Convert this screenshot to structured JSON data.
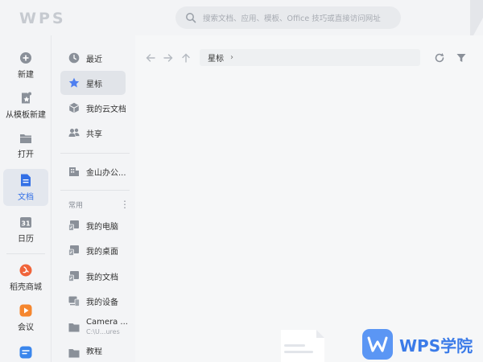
{
  "app": {
    "logo_text": "WPS",
    "search_placeholder": "搜索文档、应用、模板、Office 技巧或直接访问网址"
  },
  "rail": {
    "items": [
      {
        "label": "新建",
        "icon": "plus-circle-icon"
      },
      {
        "label": "从模板新建",
        "icon": "template-icon"
      },
      {
        "label": "打开",
        "icon": "folder-icon"
      },
      {
        "label": "文档",
        "icon": "document-icon",
        "active": true
      },
      {
        "label": "日历",
        "icon": "calendar-icon",
        "day": "31"
      },
      {
        "label": "稻壳商城",
        "icon": "daoke-icon"
      },
      {
        "label": "会议",
        "icon": "meeting-icon"
      }
    ]
  },
  "nav": {
    "items": [
      {
        "label": "最近",
        "icon": "clock-icon"
      },
      {
        "label": "星标",
        "icon": "star-icon",
        "active": true
      },
      {
        "label": "我的云文档",
        "icon": "cloud-doc-icon"
      },
      {
        "label": "共享",
        "icon": "share-icon"
      }
    ],
    "org": {
      "label": "金山办公...",
      "icon": "org-icon"
    },
    "section": {
      "title": "常用",
      "more": "⋮"
    },
    "common": [
      {
        "label": "我的电脑",
        "icon": "computer-icon"
      },
      {
        "label": "我的桌面",
        "icon": "desktop-icon"
      },
      {
        "label": "我的文档",
        "icon": "my-docs-icon"
      },
      {
        "label": "我的设备",
        "icon": "devices-icon"
      },
      {
        "label": "Camera ...",
        "sub": "C:\\U...ures",
        "icon": "folder-icon"
      },
      {
        "label": "教程",
        "sub": "",
        "icon": "folder-icon"
      }
    ]
  },
  "main": {
    "breadcrumb": "星标"
  },
  "watermark": {
    "text": "WPS学院"
  },
  "colors": {
    "accent": "#3370e6",
    "star": "#4e7ff0",
    "watermark": "#3b7be8"
  }
}
